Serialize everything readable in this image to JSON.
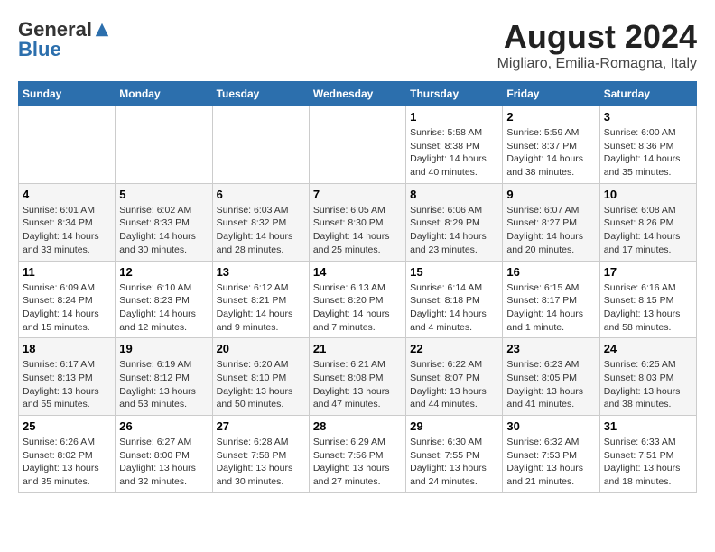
{
  "header": {
    "logo_general": "General",
    "logo_blue": "Blue",
    "main_title": "August 2024",
    "subtitle": "Migliaro, Emilia-Romagna, Italy"
  },
  "weekdays": [
    "Sunday",
    "Monday",
    "Tuesday",
    "Wednesday",
    "Thursday",
    "Friday",
    "Saturday"
  ],
  "weeks": [
    [
      {
        "day": "",
        "info": ""
      },
      {
        "day": "",
        "info": ""
      },
      {
        "day": "",
        "info": ""
      },
      {
        "day": "",
        "info": ""
      },
      {
        "day": "1",
        "info": "Sunrise: 5:58 AM\nSunset: 8:38 PM\nDaylight: 14 hours\nand 40 minutes."
      },
      {
        "day": "2",
        "info": "Sunrise: 5:59 AM\nSunset: 8:37 PM\nDaylight: 14 hours\nand 38 minutes."
      },
      {
        "day": "3",
        "info": "Sunrise: 6:00 AM\nSunset: 8:36 PM\nDaylight: 14 hours\nand 35 minutes."
      }
    ],
    [
      {
        "day": "4",
        "info": "Sunrise: 6:01 AM\nSunset: 8:34 PM\nDaylight: 14 hours\nand 33 minutes."
      },
      {
        "day": "5",
        "info": "Sunrise: 6:02 AM\nSunset: 8:33 PM\nDaylight: 14 hours\nand 30 minutes."
      },
      {
        "day": "6",
        "info": "Sunrise: 6:03 AM\nSunset: 8:32 PM\nDaylight: 14 hours\nand 28 minutes."
      },
      {
        "day": "7",
        "info": "Sunrise: 6:05 AM\nSunset: 8:30 PM\nDaylight: 14 hours\nand 25 minutes."
      },
      {
        "day": "8",
        "info": "Sunrise: 6:06 AM\nSunset: 8:29 PM\nDaylight: 14 hours\nand 23 minutes."
      },
      {
        "day": "9",
        "info": "Sunrise: 6:07 AM\nSunset: 8:27 PM\nDaylight: 14 hours\nand 20 minutes."
      },
      {
        "day": "10",
        "info": "Sunrise: 6:08 AM\nSunset: 8:26 PM\nDaylight: 14 hours\nand 17 minutes."
      }
    ],
    [
      {
        "day": "11",
        "info": "Sunrise: 6:09 AM\nSunset: 8:24 PM\nDaylight: 14 hours\nand 15 minutes."
      },
      {
        "day": "12",
        "info": "Sunrise: 6:10 AM\nSunset: 8:23 PM\nDaylight: 14 hours\nand 12 minutes."
      },
      {
        "day": "13",
        "info": "Sunrise: 6:12 AM\nSunset: 8:21 PM\nDaylight: 14 hours\nand 9 minutes."
      },
      {
        "day": "14",
        "info": "Sunrise: 6:13 AM\nSunset: 8:20 PM\nDaylight: 14 hours\nand 7 minutes."
      },
      {
        "day": "15",
        "info": "Sunrise: 6:14 AM\nSunset: 8:18 PM\nDaylight: 14 hours\nand 4 minutes."
      },
      {
        "day": "16",
        "info": "Sunrise: 6:15 AM\nSunset: 8:17 PM\nDaylight: 14 hours\nand 1 minute."
      },
      {
        "day": "17",
        "info": "Sunrise: 6:16 AM\nSunset: 8:15 PM\nDaylight: 13 hours\nand 58 minutes."
      }
    ],
    [
      {
        "day": "18",
        "info": "Sunrise: 6:17 AM\nSunset: 8:13 PM\nDaylight: 13 hours\nand 55 minutes."
      },
      {
        "day": "19",
        "info": "Sunrise: 6:19 AM\nSunset: 8:12 PM\nDaylight: 13 hours\nand 53 minutes."
      },
      {
        "day": "20",
        "info": "Sunrise: 6:20 AM\nSunset: 8:10 PM\nDaylight: 13 hours\nand 50 minutes."
      },
      {
        "day": "21",
        "info": "Sunrise: 6:21 AM\nSunset: 8:08 PM\nDaylight: 13 hours\nand 47 minutes."
      },
      {
        "day": "22",
        "info": "Sunrise: 6:22 AM\nSunset: 8:07 PM\nDaylight: 13 hours\nand 44 minutes."
      },
      {
        "day": "23",
        "info": "Sunrise: 6:23 AM\nSunset: 8:05 PM\nDaylight: 13 hours\nand 41 minutes."
      },
      {
        "day": "24",
        "info": "Sunrise: 6:25 AM\nSunset: 8:03 PM\nDaylight: 13 hours\nand 38 minutes."
      }
    ],
    [
      {
        "day": "25",
        "info": "Sunrise: 6:26 AM\nSunset: 8:02 PM\nDaylight: 13 hours\nand 35 minutes."
      },
      {
        "day": "26",
        "info": "Sunrise: 6:27 AM\nSunset: 8:00 PM\nDaylight: 13 hours\nand 32 minutes."
      },
      {
        "day": "27",
        "info": "Sunrise: 6:28 AM\nSunset: 7:58 PM\nDaylight: 13 hours\nand 30 minutes."
      },
      {
        "day": "28",
        "info": "Sunrise: 6:29 AM\nSunset: 7:56 PM\nDaylight: 13 hours\nand 27 minutes."
      },
      {
        "day": "29",
        "info": "Sunrise: 6:30 AM\nSunset: 7:55 PM\nDaylight: 13 hours\nand 24 minutes."
      },
      {
        "day": "30",
        "info": "Sunrise: 6:32 AM\nSunset: 7:53 PM\nDaylight: 13 hours\nand 21 minutes."
      },
      {
        "day": "31",
        "info": "Sunrise: 6:33 AM\nSunset: 7:51 PM\nDaylight: 13 hours\nand 18 minutes."
      }
    ]
  ]
}
